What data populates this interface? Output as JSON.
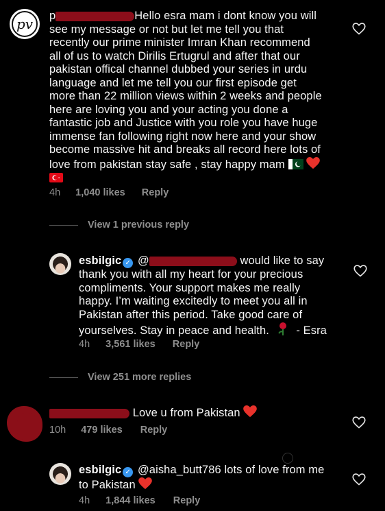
{
  "comment1": {
    "lines": [
      "Hello esra mam i dont know you will",
      "see my message or not but let me tell you that",
      "recently our prime minister Imran Khan recommend",
      "all of us to watch Dirilis Ertugrul and after that our",
      "pakistan offical channel dubbed your series in urdu",
      "language and let me tell you our first episode get",
      "more than 22 million views within 2 weeks and people",
      "here are loving you and your acting you done a",
      "fantastic job and Justice with you role you have huge",
      "immense fan following right now here and your show",
      "become massive hit and breaks all record here lots of",
      "love from pakistan stay safe , stay happy mam"
    ],
    "time": "4h",
    "likes": "1,040 likes",
    "reply": "Reply",
    "avatar_text": "pv"
  },
  "thread1": {
    "label": "View 1 previous reply"
  },
  "reply1": {
    "user": "esbilgic",
    "mention": "@",
    "lines_first": "would like to say",
    "lines": [
      "thank you with all my heart for your precious",
      "compliments. Your support makes me really",
      "happy. I’m waiting excitedly to meet you all in",
      "Pakistan after this period. Take good care of",
      "yourselves. Stay in peace and health."
    ],
    "signoff": "- Esra",
    "time": "4h",
    "likes": "3,561 likes",
    "reply": "Reply"
  },
  "thread2": {
    "label": "View 251 more replies"
  },
  "comment2": {
    "text": "Love u from Pakistan",
    "time": "10h",
    "likes": "479 likes",
    "reply": "Reply"
  },
  "reply2": {
    "user": "esbilgic",
    "mention": "@aisha_butt786",
    "text_first": "lots of love from me",
    "text_second": "to Pakistan",
    "time": "4h",
    "likes": "1,844 likes",
    "reply": "Reply"
  },
  "colors": {
    "background": "#000000",
    "text": "#f5f5f5",
    "muted": "#8e8e8e",
    "verified": "#3897f0",
    "redaction": "#8c0e1a"
  }
}
